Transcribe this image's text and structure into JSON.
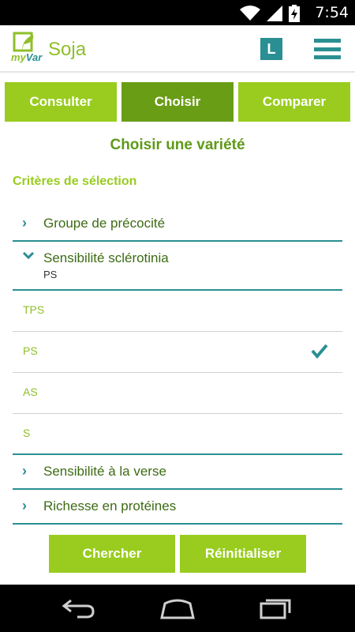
{
  "status_bar": {
    "time": "7:54",
    "icons": [
      "wifi-icon",
      "signal-icon",
      "battery-charging-icon"
    ]
  },
  "app_bar": {
    "logo_text_my": "my",
    "logo_text_var": "Var",
    "title": "Soja",
    "badge": "L",
    "menu_icon": "hamburger-menu-icon"
  },
  "tabs": [
    {
      "label": "Consulter",
      "active": false
    },
    {
      "label": "Choisir",
      "active": true
    },
    {
      "label": "Comparer",
      "active": false
    }
  ],
  "section_title": "Choisir une variété",
  "criteria_title": "Critères de sélection",
  "criteria": [
    {
      "label": "Groupe de précocité",
      "expanded": false
    },
    {
      "label": "Sensibilité sclérotinia",
      "expanded": true,
      "selected_value": "PS",
      "options": [
        {
          "label": "TPS",
          "checked": false
        },
        {
          "label": "PS",
          "checked": true
        },
        {
          "label": "AS",
          "checked": false
        },
        {
          "label": "S",
          "checked": false
        }
      ]
    },
    {
      "label": "Sensibilité à la verse",
      "expanded": false
    },
    {
      "label": "Richesse en protéines",
      "expanded": false
    }
  ],
  "buttons": {
    "search": "Chercher",
    "reset": "Réinitialiser"
  },
  "colors": {
    "green": "#99cc1f",
    "dark_green": "#6a9d16",
    "teal": "#2a8f92"
  },
  "nav_bar": {
    "icons": [
      "back-icon",
      "home-icon",
      "recent-apps-icon"
    ]
  }
}
